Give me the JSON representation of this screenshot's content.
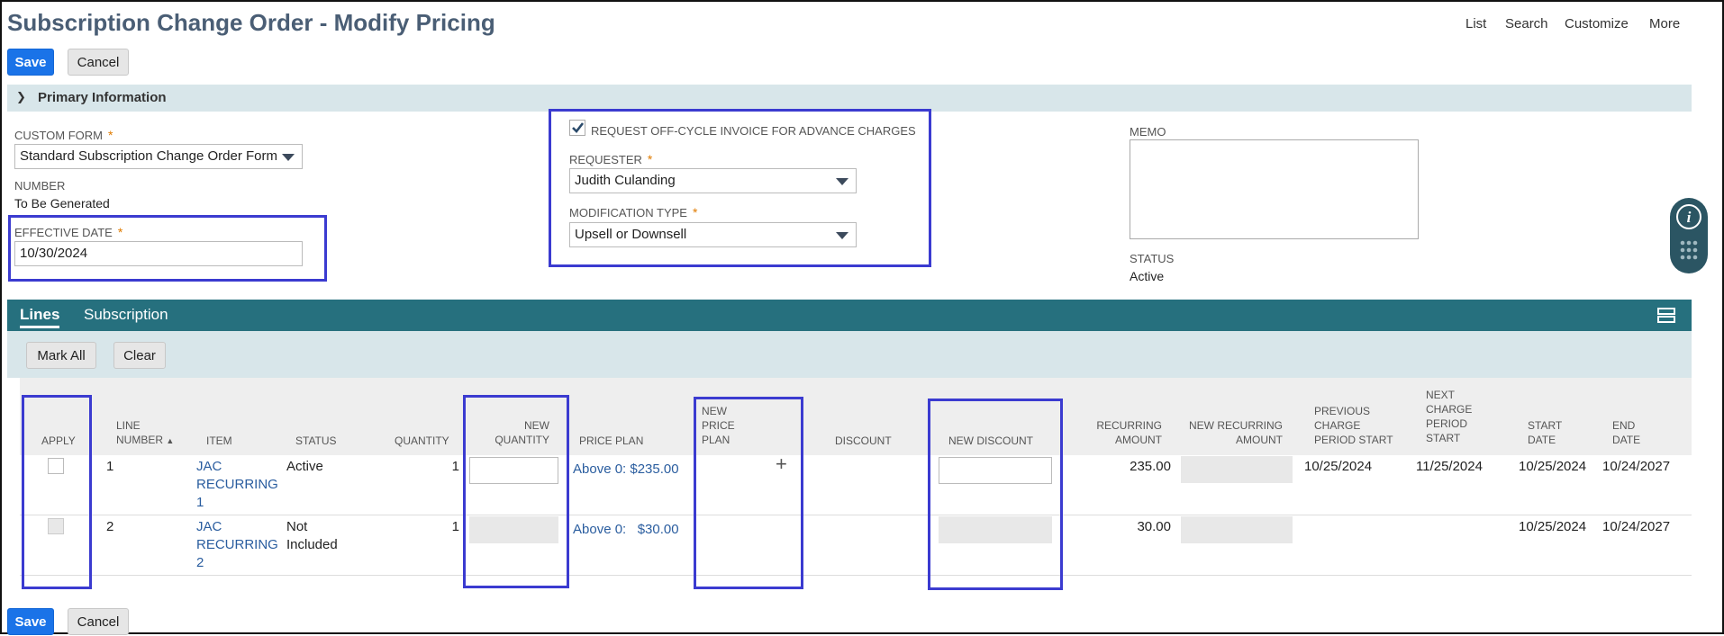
{
  "page": {
    "title": "Subscription Change Order - Modify Pricing"
  },
  "topnav": {
    "list": "List",
    "search": "Search",
    "customize": "Customize",
    "more": "More"
  },
  "toolbar": {
    "save": "Save",
    "cancel": "Cancel"
  },
  "primary": {
    "section_label": "Primary Information",
    "custom_form": {
      "label": "CUSTOM FORM",
      "value": "Standard Subscription Change Order Form"
    },
    "number": {
      "label": "NUMBER",
      "value": "To Be Generated"
    },
    "effective_date": {
      "label": "EFFECTIVE DATE",
      "value": "10/30/2024"
    },
    "off_cycle": {
      "label": "REQUEST OFF-CYCLE INVOICE FOR ADVANCE CHARGES",
      "checked": true
    },
    "requester": {
      "label": "REQUESTER",
      "value": "Judith Culanding"
    },
    "modification_type": {
      "label": "MODIFICATION TYPE",
      "value": "Upsell or Downsell"
    },
    "memo": {
      "label": "MEMO",
      "value": ""
    },
    "status": {
      "label": "STATUS",
      "value": "Active"
    }
  },
  "tabs": {
    "lines": "Lines",
    "subscription": "Subscription"
  },
  "lines": {
    "mark_all": "Mark All",
    "clear": "Clear",
    "columns": {
      "apply": "APPLY",
      "line_number_1": "LINE",
      "line_number_2": "NUMBER",
      "item": "ITEM",
      "status": "STATUS",
      "quantity": "QUANTITY",
      "new_quantity_1": "NEW",
      "new_quantity_2": "QUANTITY",
      "price_plan": "PRICE PLAN",
      "new_price_plan_1": "NEW",
      "new_price_plan_2": "PRICE",
      "new_price_plan_3": "PLAN",
      "discount": "DISCOUNT",
      "new_discount": "NEW DISCOUNT",
      "recurring_amount_1": "RECURRING",
      "recurring_amount_2": "AMOUNT",
      "new_recurring_amount_1": "NEW RECURRING",
      "new_recurring_amount_2": "AMOUNT",
      "prev_charge_1": "PREVIOUS",
      "prev_charge_2": "CHARGE",
      "prev_charge_3": "PERIOD START",
      "next_charge_1": "NEXT",
      "next_charge_2": "CHARGE",
      "next_charge_3": "PERIOD",
      "next_charge_4": "START",
      "start_date_1": "START",
      "start_date_2": "DATE",
      "end_date_1": "END",
      "end_date_2": "DATE"
    },
    "rows": [
      {
        "line": "1",
        "item_1": "JAC",
        "item_2": "RECURRING",
        "item_3": "1",
        "status_1": "Active",
        "status_2": "",
        "quantity": "1",
        "price_plan": "Above 0: $235.00",
        "new_price_plan_action": "+",
        "recurring_amount": "235.00",
        "prev_charge_start": "10/25/2024",
        "next_charge_start": "11/25/2024",
        "start_date": "10/25/2024",
        "end_date": "10/24/2027"
      },
      {
        "line": "2",
        "item_1": "JAC",
        "item_2": "RECURRING",
        "item_3": "2",
        "status_1": "Not",
        "status_2": "Included",
        "quantity": "1",
        "price_plan": "Above 0:   $30.00",
        "recurring_amount": "30.00",
        "prev_charge_start": "",
        "next_charge_start": "",
        "start_date": "10/25/2024",
        "end_date": "10/24/2027"
      }
    ]
  },
  "colors": {
    "accent": "#1a73e8",
    "tab_bar": "#26707e",
    "section": "#d8e6ea",
    "highlight": "#3b3bd0",
    "title": "#4a5e75"
  }
}
